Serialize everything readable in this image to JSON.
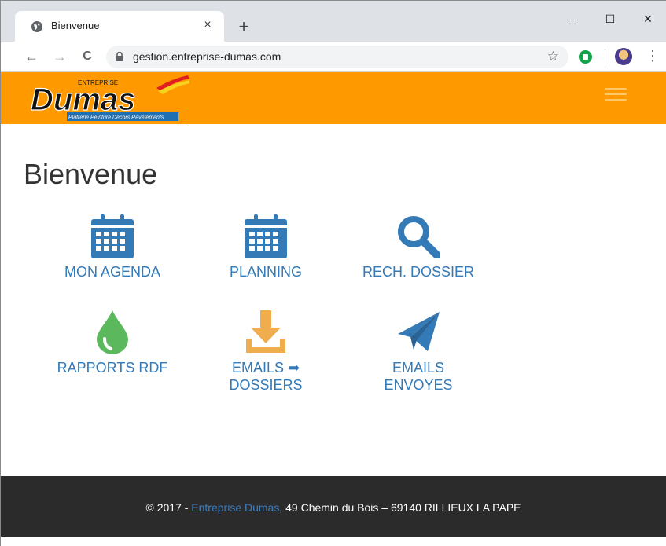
{
  "browser": {
    "tab_title": "Bienvenue",
    "tab_close": "×",
    "new_tab": "+",
    "minimize": "—",
    "maximize": "☐",
    "close": "✕",
    "back": "←",
    "forward": "→",
    "reload": "C",
    "url": "gestion.entreprise-dumas.com",
    "bookmark": "☆",
    "menu": "⋮"
  },
  "site": {
    "logo_small": "ENTREPRISE",
    "logo_name": "Dumas",
    "logo_tagline": "Plâtrerie Peinture Décors Revêtements",
    "brand_color": "#ff9900"
  },
  "page": {
    "title": "Bienvenue",
    "tiles": [
      {
        "label1": "MON AGENDA",
        "icon": "calendar-icon"
      },
      {
        "label1": "PLANNING",
        "icon": "calendar-icon"
      },
      {
        "label1": "RECH. DOSSIER",
        "icon": "search-icon"
      },
      {
        "label1": "RAPPORTS RDF",
        "icon": "drop-icon"
      },
      {
        "label1": "EMAILS ➡",
        "label2": "DOSSIERS",
        "icon": "download-icon"
      },
      {
        "label1": "EMAILS",
        "label2": "ENVOYES",
        "icon": "paper-plane-icon"
      }
    ]
  },
  "footer": {
    "prefix": "© 2017 - ",
    "link": "Entreprise Dumas",
    "suffix": ", 49 Chemin du Bois – 69140 RILLIEUX LA PAPE"
  },
  "colors": {
    "link": "#337ab7",
    "icon_blue": "#337ab7",
    "icon_green": "#5cb85c",
    "icon_orange": "#f0ad4e",
    "footer_bg": "#2b2b2b"
  }
}
